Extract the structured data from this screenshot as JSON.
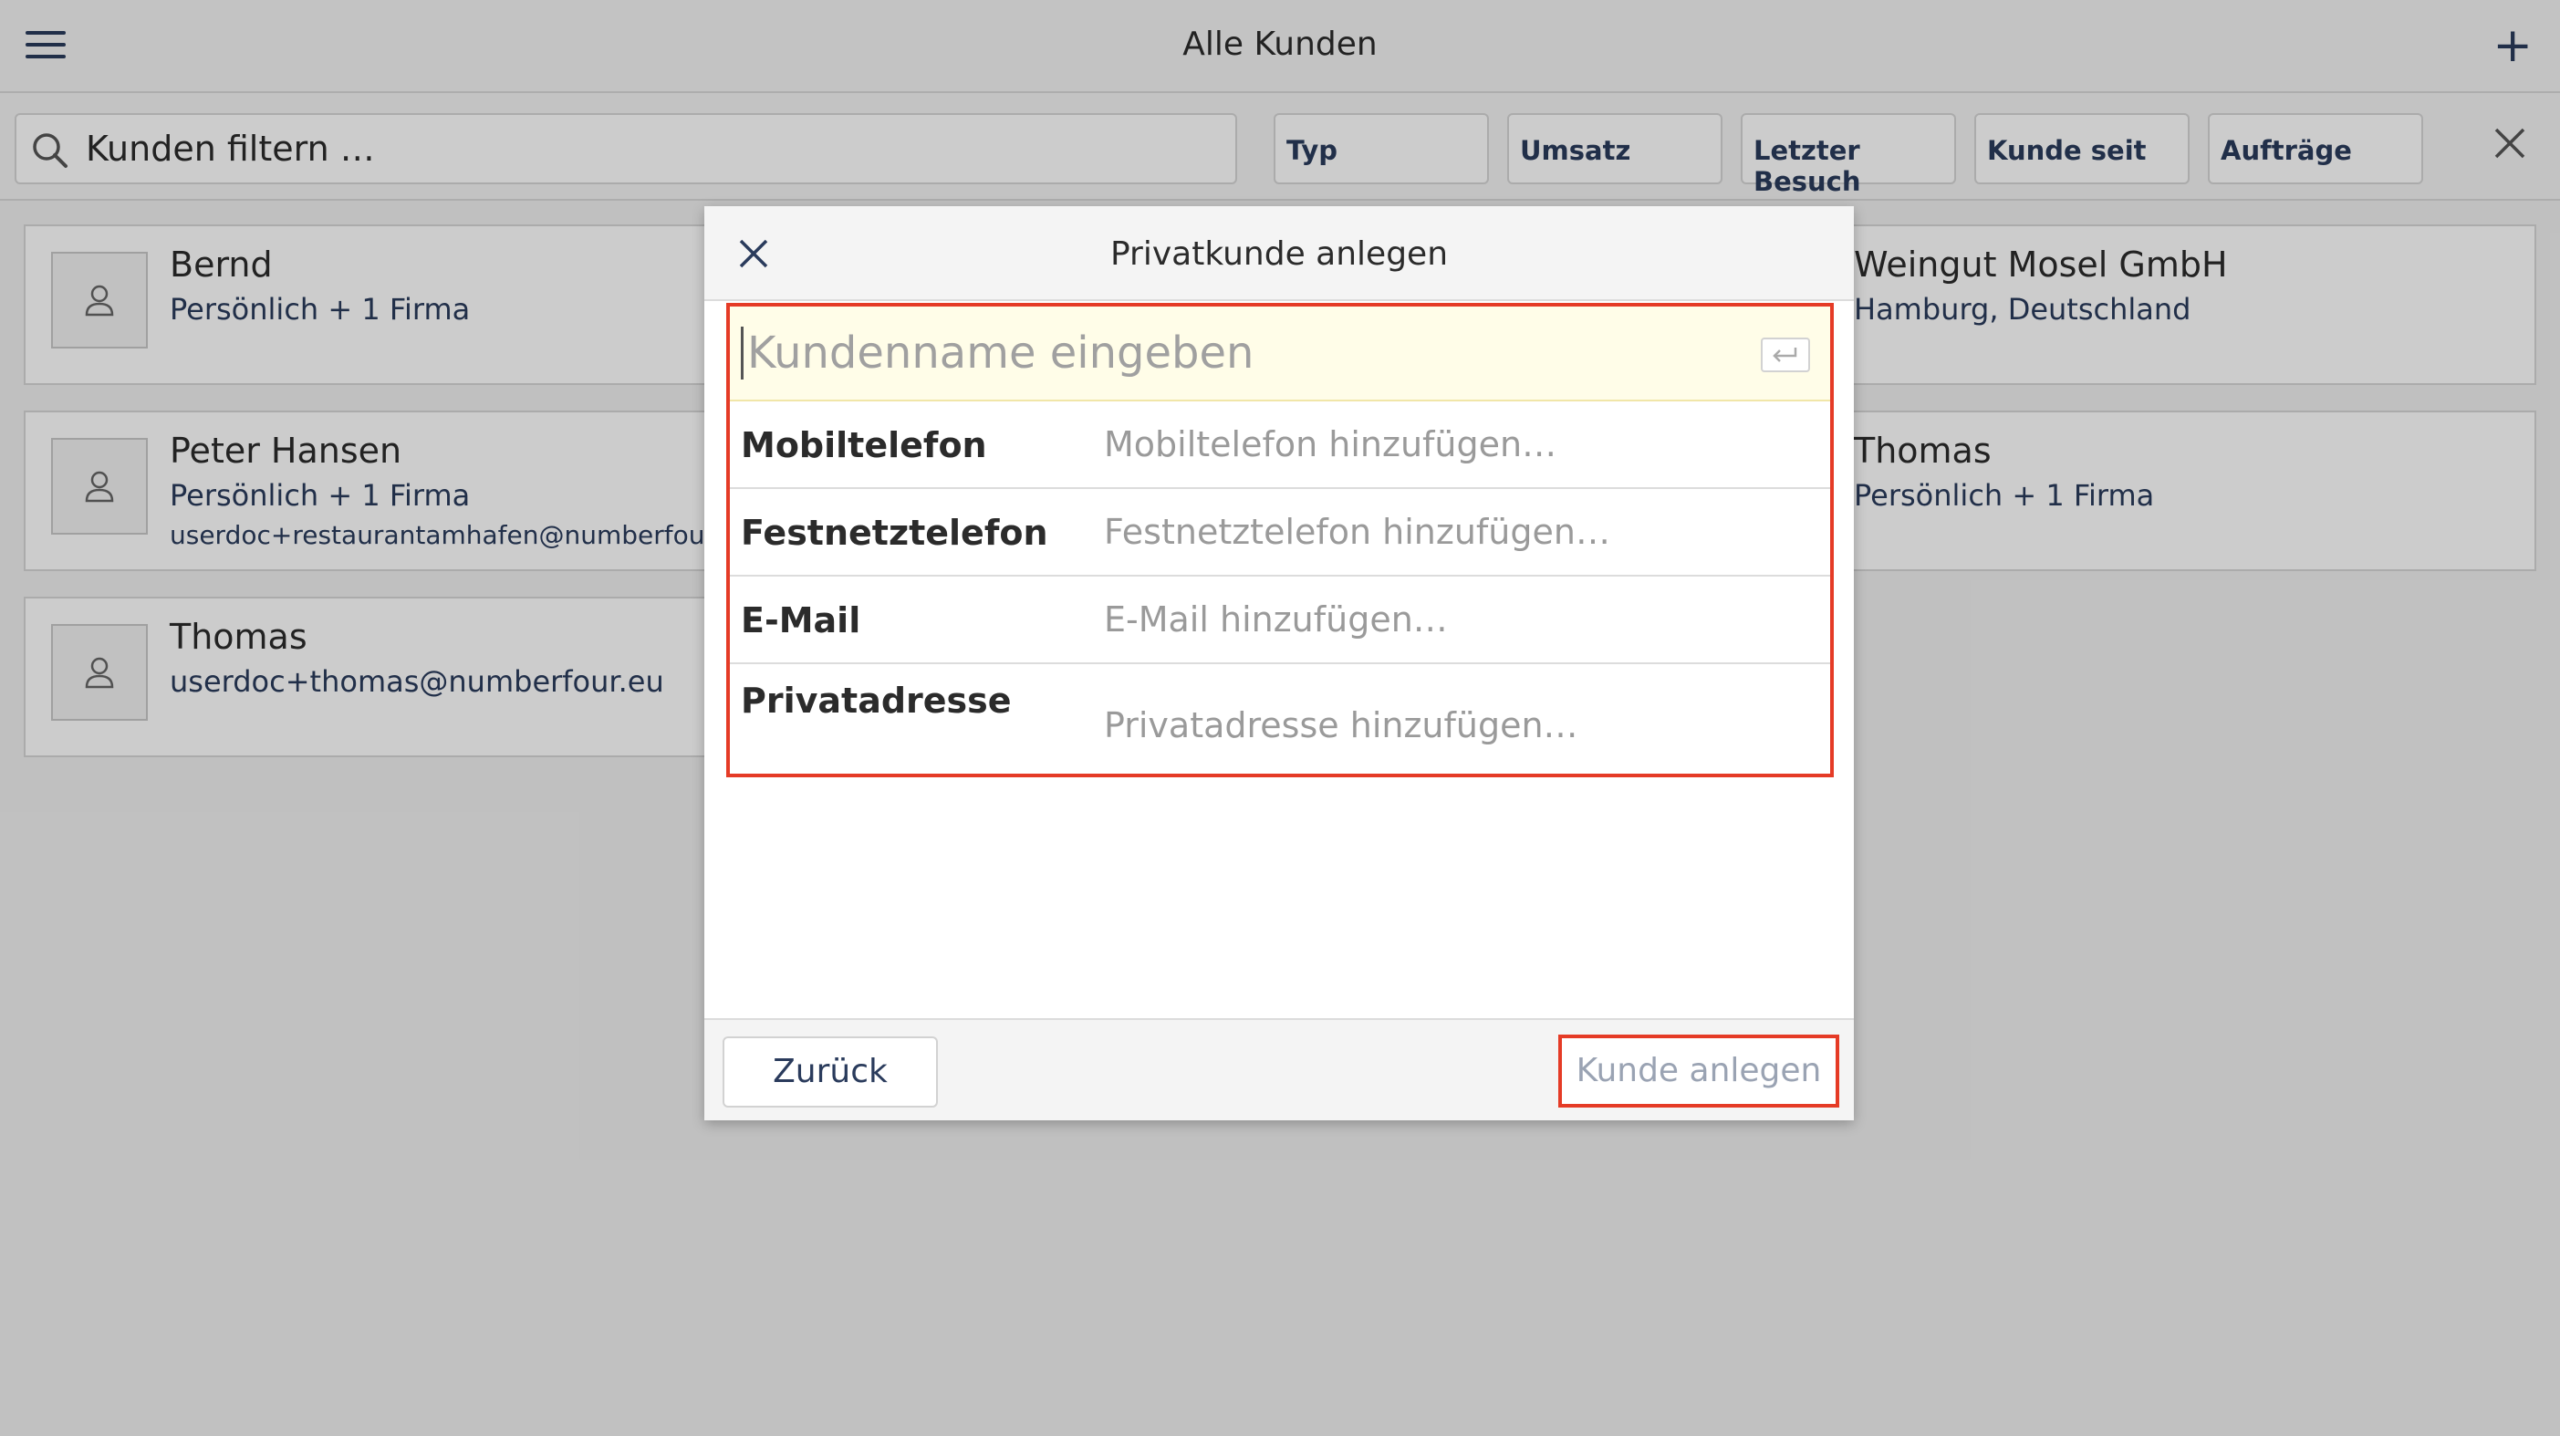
{
  "header": {
    "title": "Alle Kunden",
    "add_label": "+"
  },
  "filter": {
    "search_placeholder": "Kunden filtern …",
    "chips": [
      "Typ",
      "Umsatz",
      "Letzter Besuch",
      "Kunde seit",
      "Aufträge"
    ]
  },
  "customers": [
    {
      "name": "Bernd",
      "line1": "Persönlich + 1 Firma",
      "line2": ""
    },
    {
      "name": "Peter Hansen",
      "line1": "Persönlich + 1 Firma",
      "line2": "userdoc+restaurantamhafen@numberfour.eu"
    },
    {
      "name": "Thomas",
      "line1": "userdoc+thomas@numberfour.eu",
      "line2": ""
    },
    {
      "name": "Weingut Mosel GmbH",
      "line1": "Hamburg, Deutschland",
      "line2": ""
    },
    {
      "name": "Thomas",
      "line1": "Persönlich + 1 Firma",
      "line2": ""
    }
  ],
  "dialog": {
    "title": "Privatkunde anlegen",
    "name_placeholder": "Kundenname eingeben",
    "fields": [
      {
        "label": "Mobiltelefon",
        "placeholder": "Mobiltelefon hinzufügen…"
      },
      {
        "label": "Festnetztelefon",
        "placeholder": "Festnetztelefon hinzufügen…"
      },
      {
        "label": "E-Mail",
        "placeholder": "E-Mail hinzufügen…"
      },
      {
        "label": "Privatadresse",
        "placeholder": "Privatadresse hinzufügen…"
      }
    ],
    "back_label": "Zurück",
    "create_label": "Kunde anlegen"
  },
  "colors": {
    "highlight": "#e53b26",
    "accent": "#2a3b5c"
  }
}
